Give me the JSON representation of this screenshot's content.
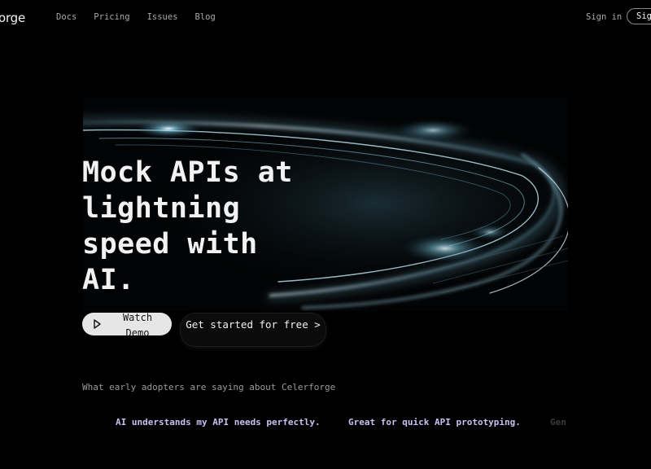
{
  "nav": {
    "logo": "orge",
    "links": [
      "Docs",
      "Pricing",
      "Issues",
      "Blog"
    ],
    "sign_in": "Sign in",
    "sign_up": "Sig"
  },
  "hero": {
    "title": "Mock APIs at lightning speed with AI.",
    "watch_demo": "Watch Demo",
    "get_started": "Get started for free >",
    "image_alt_semantic": "light-streaks-ring-image"
  },
  "testimonials": {
    "heading": "What early adopters are saying about Celerforge",
    "quotes": [
      "AI understands my API needs perfectly.",
      "Great for quick API prototyping.",
      "Gen"
    ]
  },
  "colors": {
    "background": "#000000",
    "quote_text": "#c7c1f0",
    "muted_text": "#9a9a9a"
  }
}
